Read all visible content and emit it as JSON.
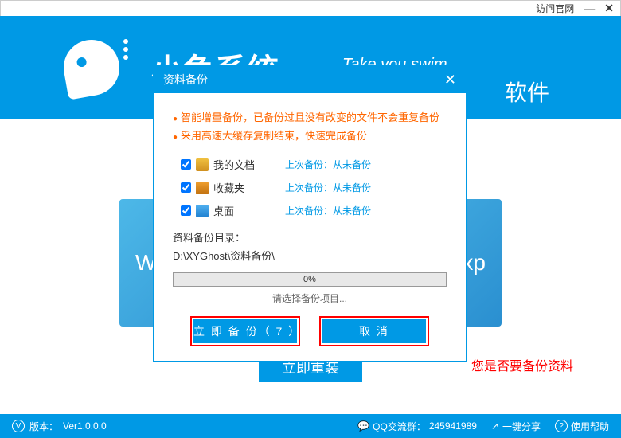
{
  "titlebar": {
    "official": "访问官网",
    "min": "—",
    "close": "✕"
  },
  "header": {
    "brand": "小鱼系统",
    "tagline": "Take you swim",
    "subbrand": "软件"
  },
  "tiles": {
    "left": "Win",
    "right": "ws xp"
  },
  "mainbtn": "立即重装",
  "footer": {
    "version_label": "版本：",
    "version": "Ver1.0.0.0",
    "qq_label": "QQ交流群：",
    "qq": "245941989",
    "share": "一键分享",
    "help": "使用帮助"
  },
  "modal": {
    "title": "资料备份",
    "info1": "智能增量备份，已备份过且没有改变的文件不会重复备份",
    "info2": "采用高速大缓存复制结束，快速完成备份",
    "items": [
      {
        "label": "我的文档",
        "last": "上次备份：从未备份"
      },
      {
        "label": "收藏夹",
        "last": "上次备份：从未备份"
      },
      {
        "label": "桌面",
        "last": "上次备份：从未备份"
      }
    ],
    "path_label": "资料备份目录：",
    "path": "D:\\XYGhost\\资料备份\\",
    "progress": "0%",
    "status": "请选择备份项目...",
    "btn_backup": "立 即 备 份（ 7 ）",
    "btn_cancel": "取  消"
  },
  "annotation": "您是否要备份资料"
}
